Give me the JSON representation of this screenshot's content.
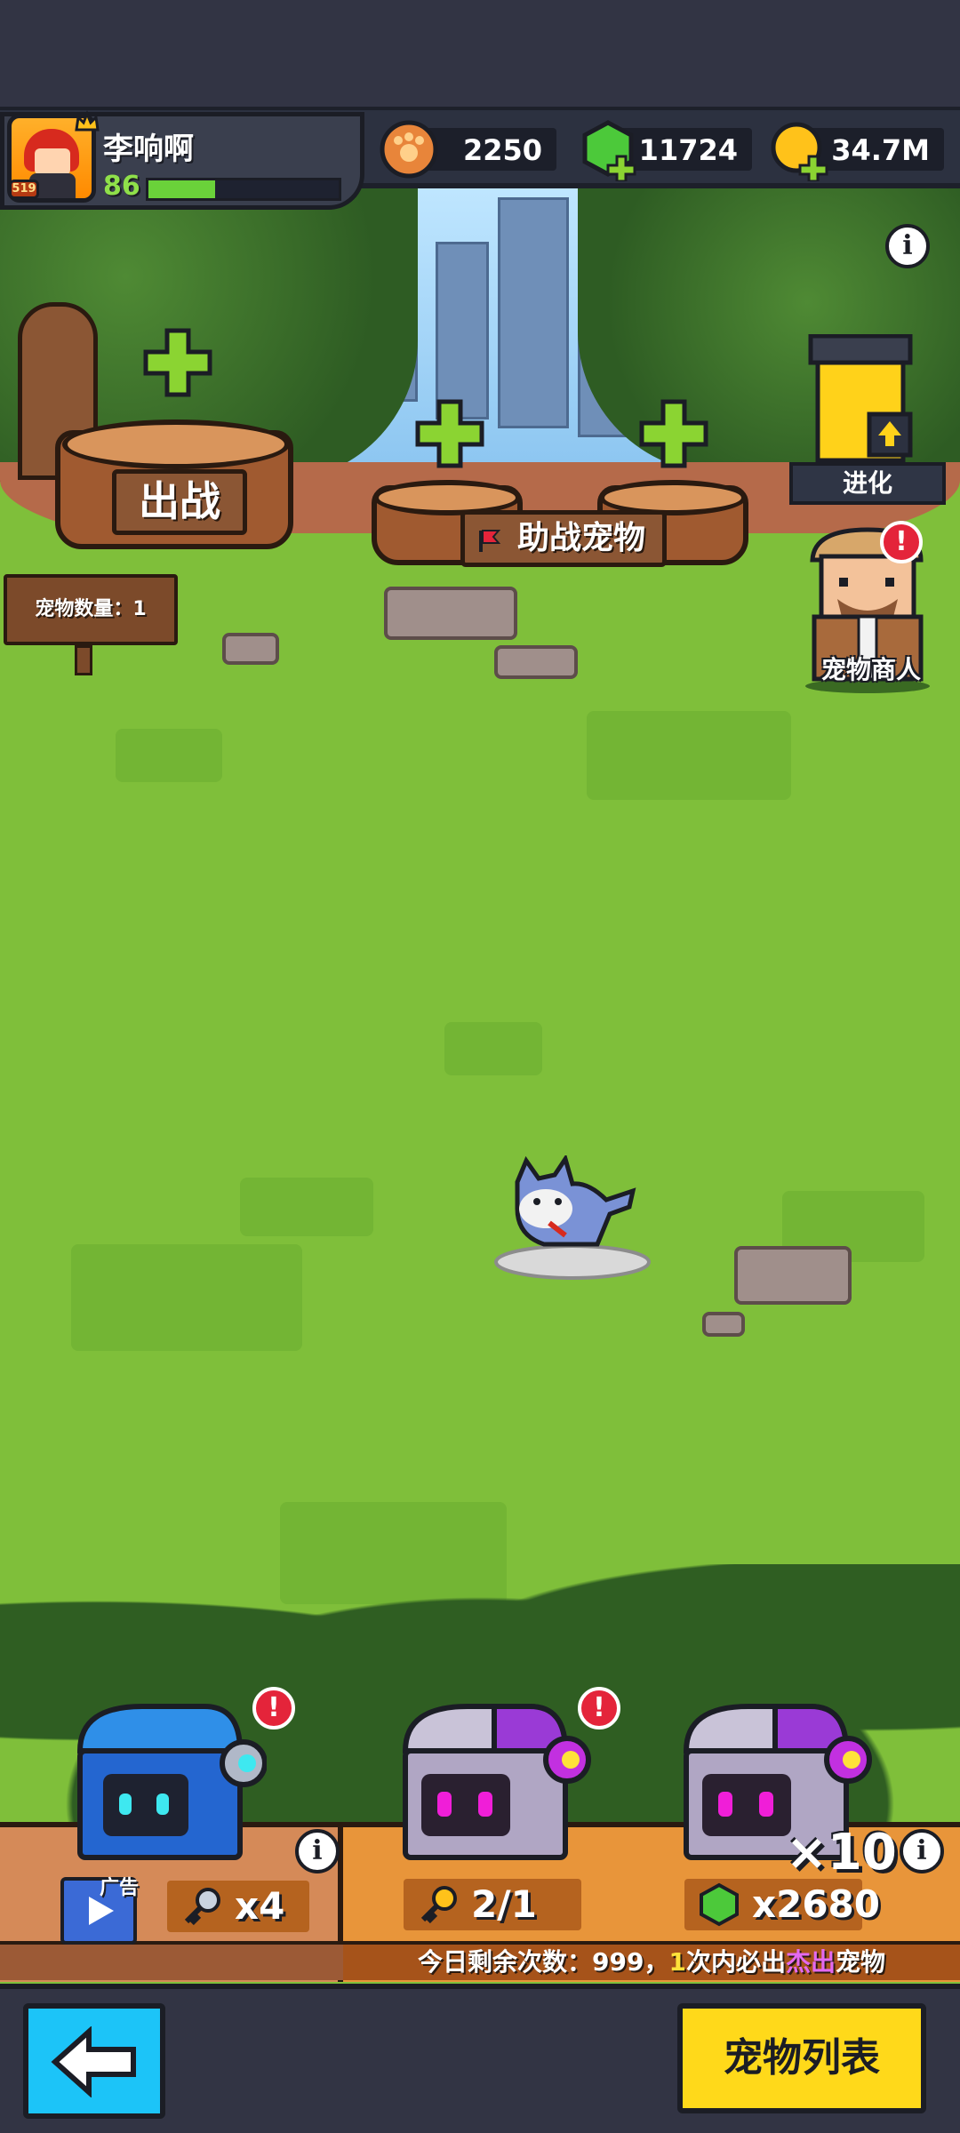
{
  "player": {
    "name": "李响啊",
    "level": "86",
    "badge": "519",
    "xp_fraction": 0.35
  },
  "currencies": [
    {
      "name": "coins",
      "icon": "paw-coin-icon",
      "value": "2250"
    },
    {
      "name": "gems",
      "icon": "green-gem-plus-icon",
      "value": "11724"
    },
    {
      "name": "gold",
      "icon": "gold-coin-plus-icon",
      "value": "34.7M"
    }
  ],
  "scene": {
    "deploy_sign": "出战",
    "assist_sign": "助战宠物",
    "pet_count_label": "宠物数量：1",
    "evolve_label": "进化",
    "merchant_label": "宠物商人"
  },
  "shop": {
    "ad_label": "广告",
    "chest_blue_cost": "x4",
    "chest_purple_cost": "2/1",
    "chest_purple10_cost": "x2680",
    "chest_purple10_multiplier": "×10",
    "footer_prefix": "今日剩余次数：999，",
    "footer_count": "1",
    "footer_middle": "次内必出",
    "footer_highlight": "杰出",
    "footer_suffix": "宠物"
  },
  "nav": {
    "pet_list_label": "宠物列表"
  },
  "colors": {
    "grass": "#7fbf3a",
    "header": "#2c3140",
    "accent_yellow": "#ffd91a",
    "accent_cyan": "#1cc4f8",
    "alert_red": "#e4243a"
  }
}
